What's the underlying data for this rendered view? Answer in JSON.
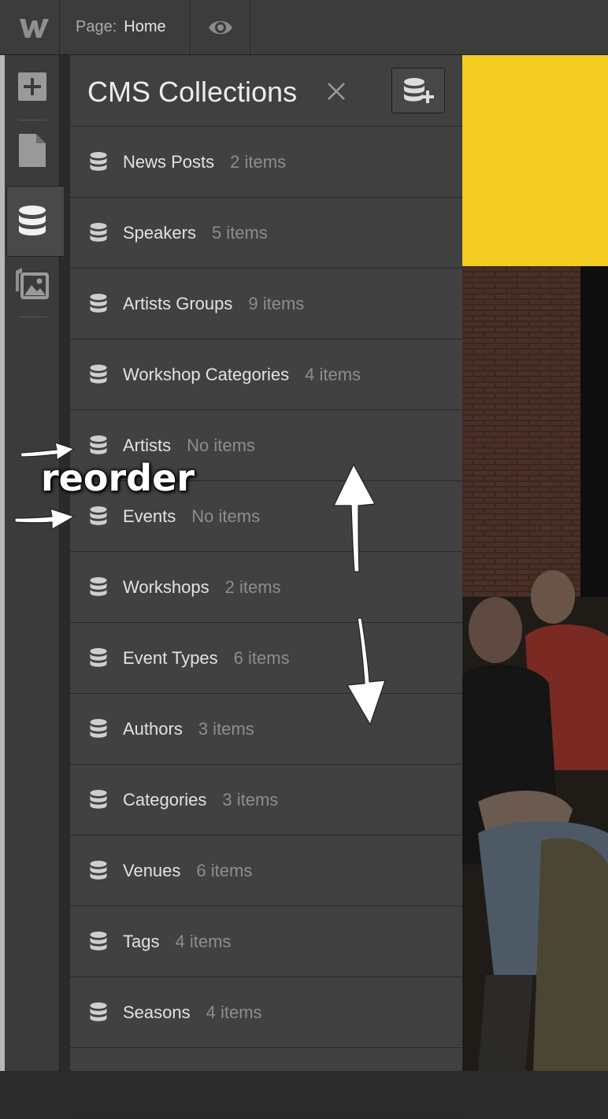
{
  "topbar": {
    "page_prefix": "Page:",
    "page_name": "Home",
    "logo_icon": "webflow-logo-icon",
    "preview_icon": "eye-icon"
  },
  "leftbar": {
    "tools": [
      {
        "icon": "add-panel-icon"
      },
      {
        "icon": "pages-icon"
      },
      {
        "icon": "cms-database-icon",
        "active": true
      },
      {
        "icon": "assets-images-icon"
      }
    ]
  },
  "panel": {
    "title": "CMS Collections",
    "close_icon": "close-icon",
    "add_collection_icon": "add-database-icon",
    "collections": [
      {
        "name": "News Posts",
        "count": "2 items"
      },
      {
        "name": "Speakers",
        "count": "5 items"
      },
      {
        "name": "Artists Groups",
        "count": "9 items"
      },
      {
        "name": "Workshop Categories",
        "count": "4 items"
      },
      {
        "name": "Artists",
        "count": "No items"
      },
      {
        "name": "Events",
        "count": "No items"
      },
      {
        "name": "Workshops",
        "count": "2 items"
      },
      {
        "name": "Event Types",
        "count": "6 items"
      },
      {
        "name": "Authors",
        "count": "3 items"
      },
      {
        "name": "Categories",
        "count": "3 items"
      },
      {
        "name": "Venues",
        "count": "6 items"
      },
      {
        "name": "Tags",
        "count": "4 items"
      },
      {
        "name": "Seasons",
        "count": "4 items"
      }
    ]
  },
  "annotation": {
    "label": "reorder"
  },
  "colors": {
    "accent_yellow": "#f4cc22",
    "panel_bg": "#414141",
    "toolbar_bg": "#3b3b3b"
  }
}
